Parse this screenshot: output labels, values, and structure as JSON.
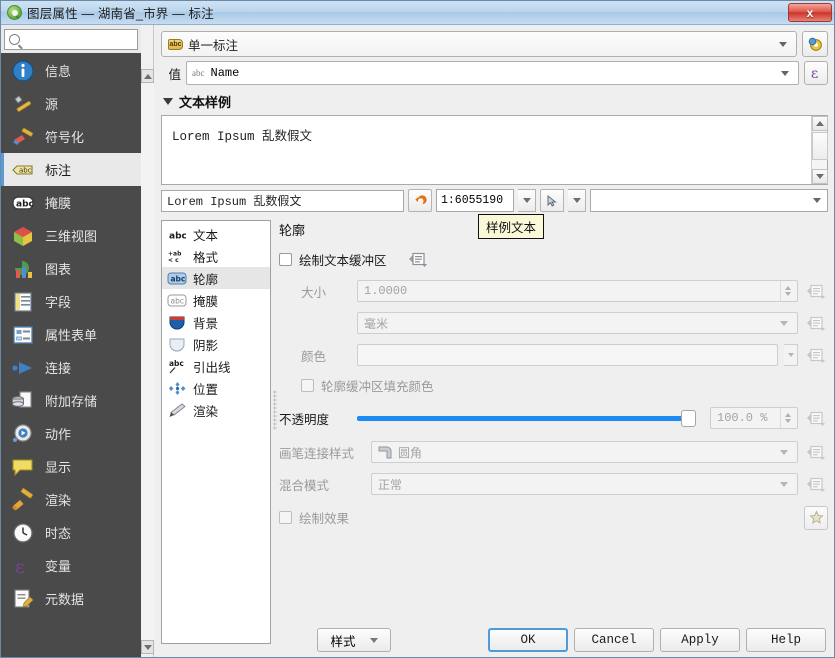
{
  "window": {
    "title": "图层属性 — 湖南省_市界 — 标注",
    "close_label": "x"
  },
  "sidebar": {
    "search_placeholder": "",
    "search_value": "",
    "items": [
      {
        "label": "信息",
        "icon": "info-icon"
      },
      {
        "label": "源",
        "icon": "source-icon"
      },
      {
        "label": "符号化",
        "icon": "symbology-icon"
      },
      {
        "label": "标注",
        "icon": "labels-icon",
        "active": true
      },
      {
        "label": "掩膜",
        "icon": "masks-icon"
      },
      {
        "label": "三维视图",
        "icon": "3d-view-icon"
      },
      {
        "label": "图表",
        "icon": "diagrams-icon"
      },
      {
        "label": "字段",
        "icon": "fields-icon"
      },
      {
        "label": "属性表单",
        "icon": "attributes-form-icon"
      },
      {
        "label": "连接",
        "icon": "joins-icon"
      },
      {
        "label": "附加存储",
        "icon": "auxiliary-storage-icon"
      },
      {
        "label": "动作",
        "icon": "actions-icon"
      },
      {
        "label": "显示",
        "icon": "display-icon"
      },
      {
        "label": "渲染",
        "icon": "rendering-icon"
      },
      {
        "label": "时态",
        "icon": "temporal-icon"
      },
      {
        "label": "变量",
        "icon": "variables-icon"
      },
      {
        "label": "元数据",
        "icon": "metadata-icon"
      }
    ]
  },
  "header": {
    "mode_label": "单一标注",
    "mode_icon": "abc-label-icon",
    "settings_icon": "gear-settings-icon",
    "value_label": "值",
    "value_field": "Name",
    "value_field_icon": "abc-text-field-icon",
    "expression_icon": "epsilon-expression-icon"
  },
  "sample": {
    "section_title": "文本样例",
    "preview_text": "Lorem Ipsum 乱数假文",
    "edit_value": "Lorem Ipsum 乱数假文",
    "undo_icon": "undo-arrow-icon",
    "scale": "1:6055190",
    "cursor_icon": "pointer-select-icon",
    "blank_value": ""
  },
  "panel_list": [
    {
      "label": "文本",
      "icon": "text-icon"
    },
    {
      "label": "格式",
      "icon": "formatting-icon"
    },
    {
      "label": "轮廓",
      "icon": "buffer-icon",
      "active": true
    },
    {
      "label": "掩膜",
      "icon": "mask-icon"
    },
    {
      "label": "背景",
      "icon": "background-icon"
    },
    {
      "label": "阴影",
      "icon": "shadow-icon"
    },
    {
      "label": "引出线",
      "icon": "callouts-icon"
    },
    {
      "label": "位置",
      "icon": "placement-icon"
    },
    {
      "label": "渲染",
      "icon": "rendering-brush-icon"
    }
  ],
  "buffer": {
    "title": "轮廓",
    "draw_buffer_label": "绘制文本缓冲区",
    "draw_buffer_checked": false,
    "size_label": "大小",
    "size_value": "1.0000",
    "unit_value": "毫米",
    "color_label": "颜色",
    "color_value": "",
    "fill_interior_label": "轮廓缓冲区填充颜色",
    "fill_interior_checked": false,
    "opacity_label": "不透明度",
    "opacity_value": "100.0 %",
    "opacity_percent": 100,
    "join_style_label": "画笔连接样式",
    "join_style_value": "圆角",
    "blend_mode_label": "混合模式",
    "blend_mode_value": "正常",
    "draw_effects_label": "绘制效果",
    "draw_effects_checked": false,
    "effects_icon": "star-effects-icon",
    "override_icon": "data-defined-override-icon"
  },
  "tooltip": {
    "text": "样例文本"
  },
  "footer": {
    "style_label": "样式",
    "ok_label": "OK",
    "cancel_label": "Cancel",
    "apply_label": "Apply",
    "help_label": "Help"
  },
  "colors": {
    "accent": "#1d8bf1",
    "sidebar_bg": "#4a4a4a",
    "titlebar": "#bcd6ee",
    "tooltip_bg": "#fbf8d9",
    "close_red": "#cb3427"
  }
}
